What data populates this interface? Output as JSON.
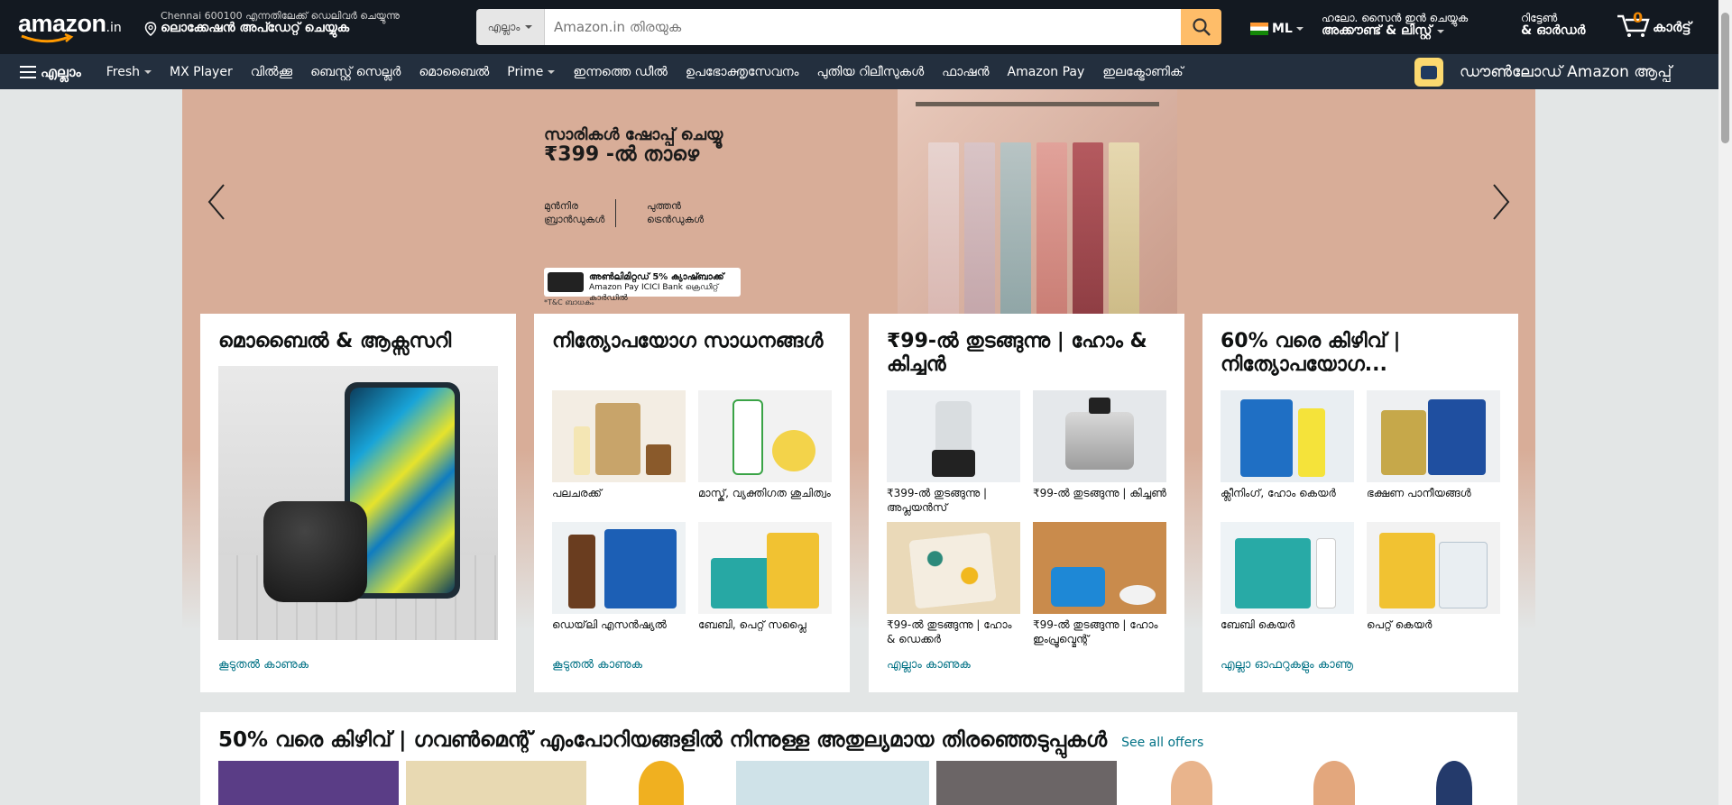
{
  "header": {
    "logo_text": "amazon",
    "logo_tld": ".in",
    "deliver_line1": "Chennai 600100 എന്നതിലേക്ക് ഡെലിവർ ചെയ്യുന്നു",
    "deliver_line2": "ലൊക്കേഷൻ അപ്ഡേറ്റ് ചെയ്യുക",
    "search_category": "എല്ലാം",
    "search_placeholder": "Amazon.in തിരയുക",
    "language": "ML",
    "account_line1": "ഹലോ. സൈൻ ഇൻ ചെയ്യുക",
    "account_line2": "അക്കൗണ്ട് & ലിസ്റ്റ്",
    "returns_line1": "റിട്ടേൺ",
    "returns_line2": "& ഓർഡർ",
    "cart_count": "0",
    "cart_label": "കാർട്ട്"
  },
  "subnav": {
    "all": "എല്ലാം",
    "items": [
      "Fresh",
      "MX Player",
      "വിൽക്കൂ",
      "ബെസ്റ്റ് സെല്ലർ",
      "മൊബൈൽ",
      "Prime",
      "ഇന്നത്തെ ഡീൽ",
      "ഉപഭോക്തൃസേവനം",
      "പുതിയ റിലീസുകൾ",
      "ഫാഷൻ",
      "Amazon Pay",
      "ഇലക്ട്രോണിക്"
    ],
    "app_download": "ഡൗൺലോഡ് Amazon ആപ്പ്"
  },
  "hero": {
    "headline1": "സാരികൾ ഷോപ്പ് ചെയ്യൂ",
    "headline2": "₹399 -ൽ താഴെ",
    "tag1_line1": "മുൻനിര",
    "tag1_line2": "ബ്രാൻഡുകൾ",
    "tag2_line1": "പുത്തൻ",
    "tag2_line2": "ട്രെൻഡുകൾ",
    "offer_bold": "അൺലിമിറ്റഡ് 5% ക്യാഷ്ബാക്ക്",
    "offer_sub": "Amazon Pay ICICI Bank ക്രെഡിറ്റ് കാർഡിൽ",
    "tnc": "*T&C ബാധകം"
  },
  "cards": [
    {
      "title": "മൊബൈൽ & ആക്സസറി",
      "more": "കൂടുതൽ കാണുക"
    },
    {
      "title": "നിത്യോപയോഗ സാധനങ്ങൾ",
      "tiles": [
        "പലചരക്ക്",
        "മാസ്ക്, വ്യക്തിഗത ശുചിത്വം",
        "ഡെയ്‌ലി എസൻഷ്യൽ",
        "ബേബി, പെറ്റ് സപ്ലൈ"
      ],
      "more": "കൂടുതൽ കാണുക"
    },
    {
      "title": "₹99-ൽ തുടങ്ങുന്നു | ഹോം & കിച്ചൻ",
      "tiles": [
        "₹399-ൽ തുടങ്ങുന്നു | അപ്ലയൻസ്",
        "₹99-ൽ തുടങ്ങുന്നു | കിച്ചൺ",
        "₹99-ൽ തുടങ്ങുന്നു | ഹോം & ഡെക്കർ",
        "₹99-ൽ തുടങ്ങുന്നു | ഹോം ഇംപ്രൂവ്മെന്റ്"
      ],
      "more": "എല്ലാം കാണുക"
    },
    {
      "title": "60% വരെ കിഴിവ് | നിത്യോപയോഗ...",
      "tiles": [
        "ക്ലീനിംഗ്, ഹോം കെയർ",
        "ഭക്ഷണ പാനീയങ്ങൾ",
        "ബേബി കെയർ",
        "പെറ്റ് കെയർ"
      ],
      "more": "എല്ലാ ഓഫറുകളും കാണൂ"
    }
  ],
  "strip": {
    "title": "50% വരെ കിഴിവ് | ഗവൺമെന്റ് എംപോറിയങ്ങളിൽ നിന്നുള്ള അതുല്യമായ തിരഞ്ഞെടുപ്പുകൾ",
    "see_all": "See all offers"
  },
  "colors": {
    "nav_dark": "#131921",
    "nav_sub": "#232f3e",
    "search_button": "#febd69",
    "cart_count": "#f08804",
    "link": "#007185"
  }
}
